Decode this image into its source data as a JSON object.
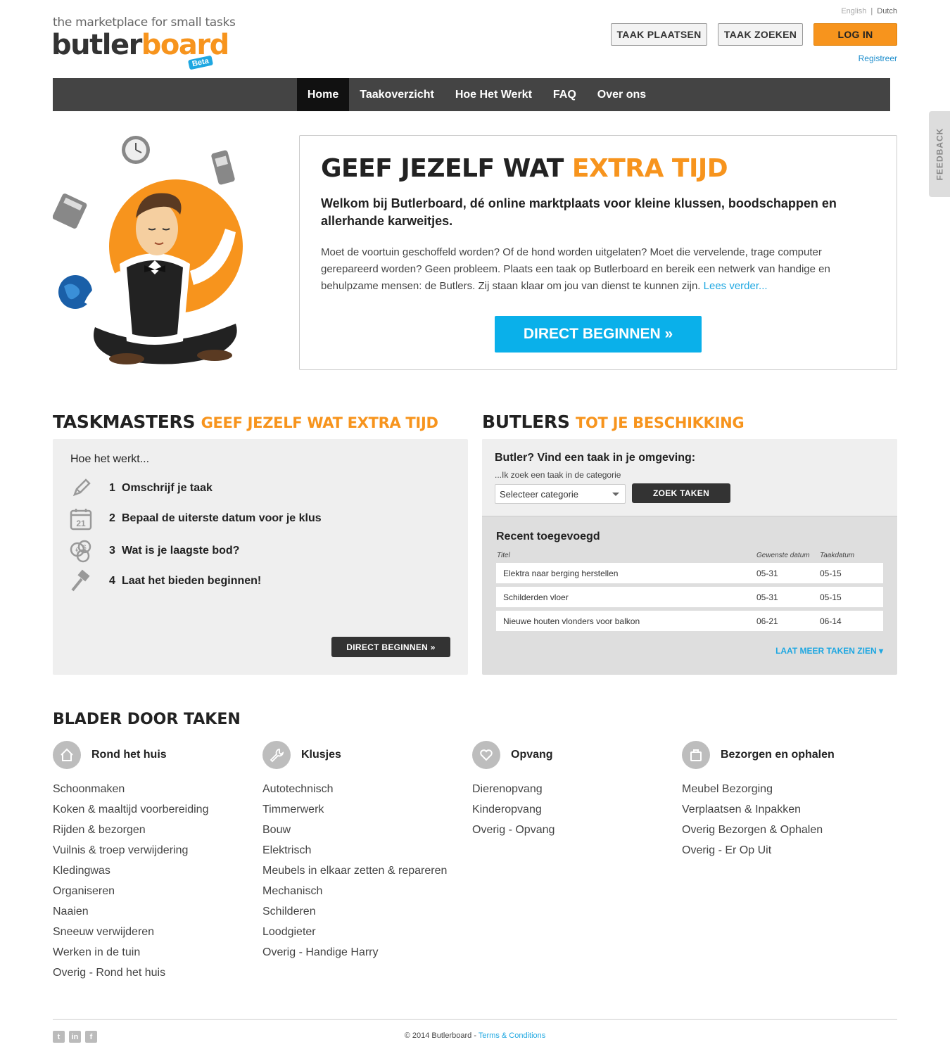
{
  "header": {
    "tagline": "the marketplace for small tasks",
    "logo_part1": "butler",
    "logo_part2": "board",
    "beta": "Beta",
    "lang_english": "English",
    "lang_dutch": "Dutch",
    "btn_post": "TAAK PLAATSEN",
    "btn_search": "TAAK ZOEKEN",
    "btn_login": "LOG IN",
    "register": "Registreer"
  },
  "nav": {
    "items": [
      "Home",
      "Taakoverzicht",
      "Hoe Het Werkt",
      "FAQ",
      "Over ons"
    ]
  },
  "hero": {
    "title_dark": "GEEF JEZELF WAT",
    "title_orange": "EXTRA TIJD",
    "lead": "Welkom bij Butlerboard, dé online marktplaats voor kleine klussen, boodschappen en allerhande karweitjes.",
    "text": "Moet de voortuin geschoffeld worden? Of de hond worden uitgelaten? Moet die vervelende, trage computer gerepareerd worden? Geen probleem. Plaats een taak op Butlerboard en bereik een netwerk van handige en behulpzame mensen: de Butlers. Zij staan klaar om jou van dienst te kunnen zijn.",
    "read_more": "Lees verder...",
    "cta": "DIRECT BEGINNEN »"
  },
  "taskmasters": {
    "head_dark": "TASKMASTERS",
    "head_orange": "GEEF JEZELF WAT EXTRA TIJD",
    "how_title": "Hoe het werkt...",
    "steps": [
      {
        "num": "1",
        "text": "Omschrijf je taak",
        "icon": "pencil-icon"
      },
      {
        "num": "2",
        "text": "Bepaal de uiterste datum voor je klus",
        "icon": "calendar-icon"
      },
      {
        "num": "3",
        "text": "Wat is je laagste bod?",
        "icon": "coins-icon"
      },
      {
        "num": "4",
        "text": "Laat het bieden beginnen!",
        "icon": "gavel-icon"
      }
    ],
    "cta": "DIRECT BEGINNEN »"
  },
  "butlers": {
    "head_dark": "BUTLERS",
    "head_orange": "TOT JE BESCHIKKING",
    "question": "Butler? Vind een taak in je omgeving:",
    "sub": "...Ik zoek een taak in de categorie",
    "select_value": "Selecteer categorie",
    "search_btn": "ZOEK TAKEN",
    "recent_title": "Recent toegevoegd",
    "col_title": "Titel",
    "col_desired": "Gewenste datum",
    "col_taskdate": "Taakdatum",
    "rows": [
      {
        "title": "Elektra naar berging herstellen",
        "desired": "05-31",
        "date": "05-15"
      },
      {
        "title": "Schilderden vloer",
        "desired": "05-31",
        "date": "05-15"
      },
      {
        "title": "Nieuwe houten vlonders voor balkon",
        "desired": "06-21",
        "date": "06-14"
      }
    ],
    "more": "LAAT MEER TAKEN ZIEN"
  },
  "browse": {
    "title": "BLADER DOOR TAKEN",
    "categories": [
      {
        "name": "Rond het huis",
        "icon": "house-icon",
        "items": [
          "Schoonmaken",
          "Koken & maaltijd voorbereiding",
          "Rijden & bezorgen",
          "Vuilnis & troep verwijdering",
          "Kledingwas",
          "Organiseren",
          "Naaien",
          "Sneeuw verwijderen",
          "Werken in de tuin",
          "Overig - Rond het huis"
        ]
      },
      {
        "name": "Klusjes",
        "icon": "wrench-icon",
        "items": [
          "Autotechnisch",
          "Timmerwerk",
          "Bouw",
          "Elektrisch",
          "Meubels in elkaar zetten & repareren",
          "Mechanisch",
          "Schilderen",
          "Loodgieter",
          "Overig - Handige Harry"
        ]
      },
      {
        "name": "Opvang",
        "icon": "heart-icon",
        "items": [
          "Dierenopvang",
          "Kinderopvang",
          "Overig - Opvang"
        ]
      },
      {
        "name": "Bezorgen en ophalen",
        "icon": "bag-icon",
        "items": [
          "Meubel Bezorging",
          "Verplaatsen & Inpakken",
          "Overig Bezorgen & Ophalen",
          "Overig - Er Op Uit"
        ]
      }
    ]
  },
  "footer": {
    "copyright": "© 2014 Butlerboard - ",
    "terms": "Terms & Conditions"
  },
  "feedback": "FEEDBACK",
  "colors": {
    "orange": "#f7941d",
    "blue": "#1ea7e1",
    "dark": "#444444"
  }
}
